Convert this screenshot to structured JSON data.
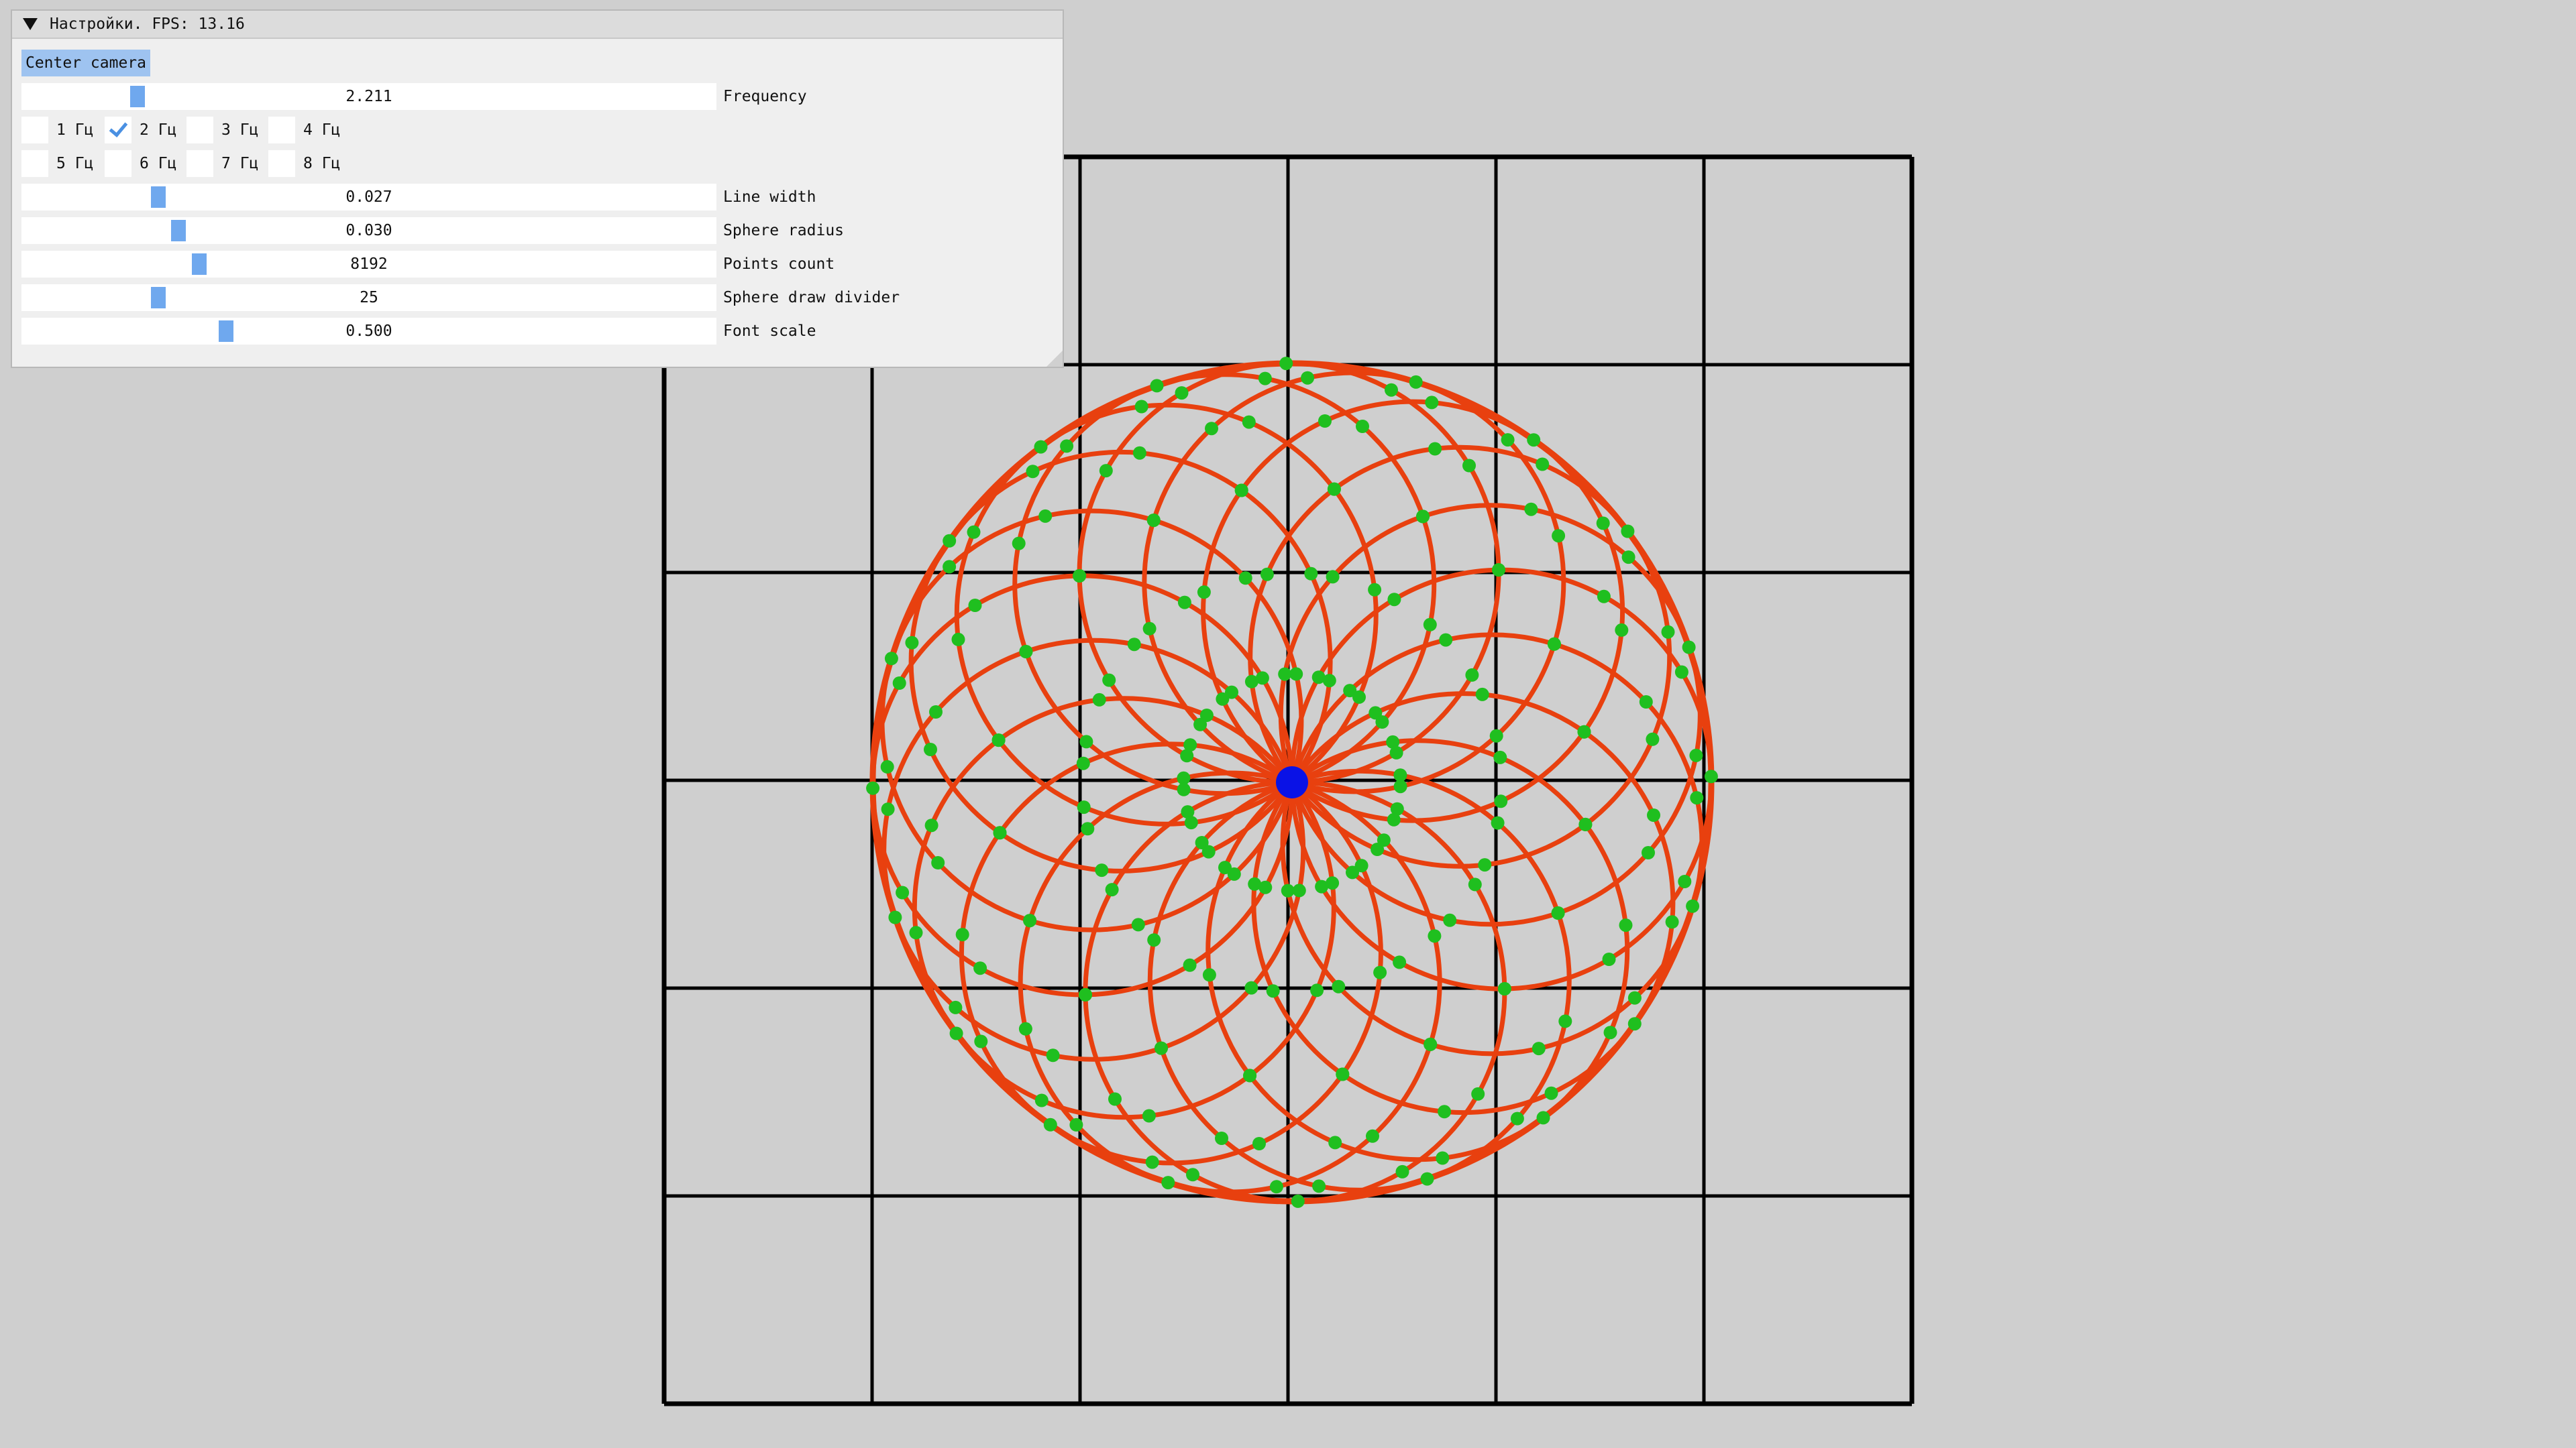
{
  "window": {
    "title": "Настройки. FPS: 13.16"
  },
  "controls": {
    "center_camera_label": "Center camera",
    "sliders": [
      {
        "value": "2.211",
        "label": "Frequency",
        "fraction": 0.16
      },
      {
        "value": "0.027",
        "label": "Line width",
        "fraction": 0.19
      },
      {
        "value": "0.030",
        "label": "Sphere radius",
        "fraction": 0.22
      },
      {
        "value": "8192",
        "label": "Points count",
        "fraction": 0.25
      },
      {
        "value": "25",
        "label": "Sphere draw divider",
        "fraction": 0.19
      },
      {
        "value": "0.500",
        "label": "Font scale",
        "fraction": 0.29
      }
    ],
    "frequency_options": [
      {
        "label": "1 Гц",
        "checked": false
      },
      {
        "label": "2 Гц",
        "checked": true
      },
      {
        "label": "3 Гц",
        "checked": false
      },
      {
        "label": "4 Гц",
        "checked": false
      },
      {
        "label": "5 Гц",
        "checked": false
      },
      {
        "label": "6 Гц",
        "checked": false
      },
      {
        "label": "7 Гц",
        "checked": false
      },
      {
        "label": "8 Гц",
        "checked": false
      }
    ]
  },
  "scene": {
    "grid_color": "#000000",
    "curve_color": "#e8400f",
    "point_color": "#1fbf1f",
    "center_point_color": "#0a12e6",
    "background": "#cfcfcf"
  }
}
